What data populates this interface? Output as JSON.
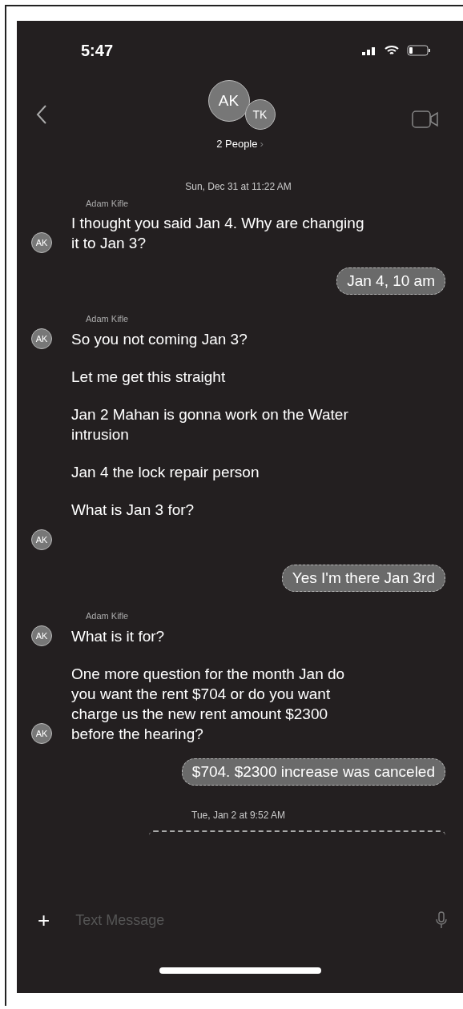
{
  "status_bar": {
    "time": "5:47"
  },
  "header": {
    "avatars": [
      "AK",
      "TK"
    ],
    "title": "2 People",
    "chevron": "›"
  },
  "messages": [
    {
      "kind": "timestamp",
      "text": "Sun, Dec 31 at 11:22 AM"
    },
    {
      "kind": "sender",
      "text": "Adam Kifle"
    },
    {
      "kind": "incoming",
      "text": "I thought you said Jan 4. Why are changing it to Jan 3?",
      "avatar": "AK"
    },
    {
      "kind": "outgoing",
      "text": "Jan 4, 10 am"
    },
    {
      "kind": "sender",
      "text": "Adam Kifle"
    },
    {
      "kind": "incoming",
      "text": "So you not coming Jan 3?",
      "avatar": "AK"
    },
    {
      "kind": "incoming",
      "text": "Let me get this straight"
    },
    {
      "kind": "incoming",
      "text": "Jan 2 Mahan is gonna work on the Water intrusion"
    },
    {
      "kind": "incoming",
      "text": "Jan 4 the lock repair person"
    },
    {
      "kind": "incoming",
      "text": "What is Jan 3 for?"
    },
    {
      "kind": "avatar",
      "avatar": "AK"
    },
    {
      "kind": "outgoing",
      "text": "Yes I'm there Jan 3rd"
    },
    {
      "kind": "sender",
      "text": "Adam Kifle"
    },
    {
      "kind": "incoming",
      "text": "What is it for?",
      "avatar": "AK"
    },
    {
      "kind": "incoming",
      "text": "One more question for the month Jan do you want the rent $704 or do you want charge us the new rent amount $2300 before the hearing?",
      "avatar": "AK"
    },
    {
      "kind": "outgoing",
      "text": "$704. $2300 increase was canceled"
    },
    {
      "kind": "timestamp",
      "text": "Tue, Jan 2 at 9:52 AM"
    },
    {
      "kind": "partial"
    }
  ],
  "composer": {
    "plus": "+",
    "placeholder": "Text Message"
  }
}
